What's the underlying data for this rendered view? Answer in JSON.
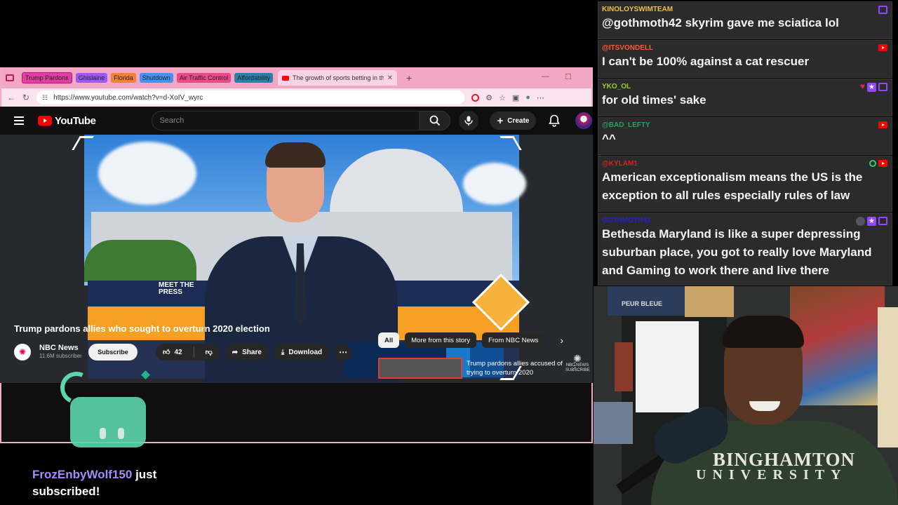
{
  "browser": {
    "tab_groups": [
      {
        "label": "Trump Pardons",
        "color": "#e040a0"
      },
      {
        "label": "Ghislaine",
        "color": "#9b59f0"
      },
      {
        "label": "Florida",
        "color": "#f0803c"
      },
      {
        "label": "Shutdown",
        "color": "#4a90f0"
      },
      {
        "label": "Air Traffic Control",
        "color": "#e84a8a"
      },
      {
        "label": "Affordability",
        "color": "#2e7fa8"
      }
    ],
    "active_tab_title": "The growth of sports betting in th",
    "url": "https://www.youtube.com/watch?v=d-XoIV_wyrc"
  },
  "youtube": {
    "logo_text": "YouTube",
    "search_placeholder": "Search",
    "create_label": "Create",
    "video_title": "Trump pardons allies who sought to overturn 2020 election",
    "channel_name": "NBC News",
    "channel_subs": "11.6M subscribers",
    "subscribe_label": "Subscribe",
    "like_count": "42",
    "share_label": "Share",
    "download_label": "Download",
    "overlay_logo": "MEET THE PRESS",
    "watermark": "NBC NEWS SUBSCRIBE",
    "chips": [
      "All",
      "More from this story",
      "From NBC News"
    ],
    "related_title": "Trump pardons allies accused of trying to overturn 2020"
  },
  "alert": {
    "username": "FrozEnbyWolf150",
    "text": "just subscribed!"
  },
  "chat": [
    {
      "user": "KINOLOYSWIMTEAM",
      "color": "#f0c040",
      "text": "@gothmoth42 skyrim gave me sciatica lol",
      "icons": [
        "twitch-icon"
      ]
    },
    {
      "user": "@ITSVONDELL",
      "color": "#ff5a36",
      "text": "I can't be 100% against a cat rescuer",
      "icons": [
        "youtube-icon"
      ]
    },
    {
      "user": "YKO_OL",
      "color": "#9acd32",
      "text": "for old times' sake",
      "icons": [
        "heart-badge-icon",
        "star-badge-icon",
        "twitch-icon"
      ]
    },
    {
      "user": "@BAD_LEFTY",
      "color": "#23a55a",
      "text": "^^",
      "icons": [
        "youtube-icon"
      ]
    },
    {
      "user": "@KYLAM1",
      "color": "#e0201e",
      "text": "American exceptionalism means the US is the exception to all rules especially rules of law",
      "icons": [
        "green-badge-icon",
        "youtube-icon"
      ]
    },
    {
      "user": "GOTHMOTH42",
      "color": "#2020d0",
      "text": "Bethesda Maryland is like a super depressing suburban place, you got to really love Maryland and Gaming to work there and live there",
      "icons": [
        "mod-badge-icon",
        "star-badge-icon",
        "twitch-icon"
      ]
    }
  ],
  "webcam": {
    "hoodie_line1": "BINGHAMTON",
    "hoodie_line2": "UNIVERSITY",
    "poster_text": "PEUR BLEUE"
  }
}
